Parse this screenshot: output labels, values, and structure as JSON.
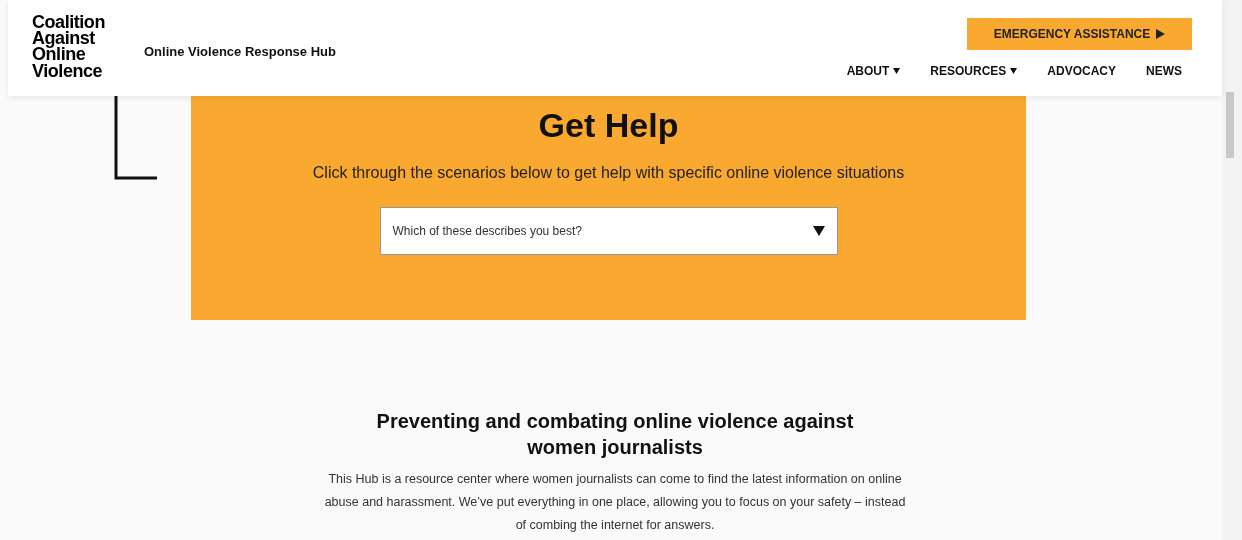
{
  "header": {
    "logo": "Coalition Against Online Violence",
    "site_title": "Online Violence Response Hub",
    "emergency_button": "EMERGENCY ASSISTANCE",
    "nav": [
      {
        "label": "ABOUT",
        "has_menu": true
      },
      {
        "label": "RESOURCES",
        "has_menu": true
      },
      {
        "label": "ADVOCACY",
        "has_menu": false
      },
      {
        "label": "NEWS",
        "has_menu": false
      }
    ]
  },
  "get_help": {
    "title": "Get Help",
    "subtitle": "Click through the scenarios below to get help with specific online violence situations",
    "select": {
      "placeholder": "Which of these describes you best?"
    }
  },
  "intro": {
    "heading": "Preventing and combating online violence against women journalists",
    "body": "This Hub is a resource center where women journalists can come to find the latest information on online abuse and harassment. We’ve put everything in one place, allowing you to focus on your safety – instead of combing the internet for answers."
  }
}
